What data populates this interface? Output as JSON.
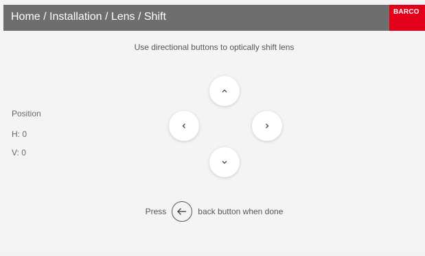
{
  "header": {
    "breadcrumb": "Home / Installation / Lens / Shift",
    "logo": "BARCO",
    "background_color": "#6e6e6e",
    "logo_color": "#e3001b"
  },
  "instruction": "Use directional buttons to optically shift lens",
  "position": {
    "label": "Position",
    "h": "H: 0",
    "v": "V: 0"
  },
  "controls": {
    "up_icon": "chevron-up-icon",
    "left_icon": "chevron-left-icon",
    "right_icon": "chevron-right-icon",
    "down_icon": "chevron-down-icon"
  },
  "footer": {
    "press": "Press",
    "back_icon": "arrow-left-icon",
    "done": "back button when done"
  }
}
